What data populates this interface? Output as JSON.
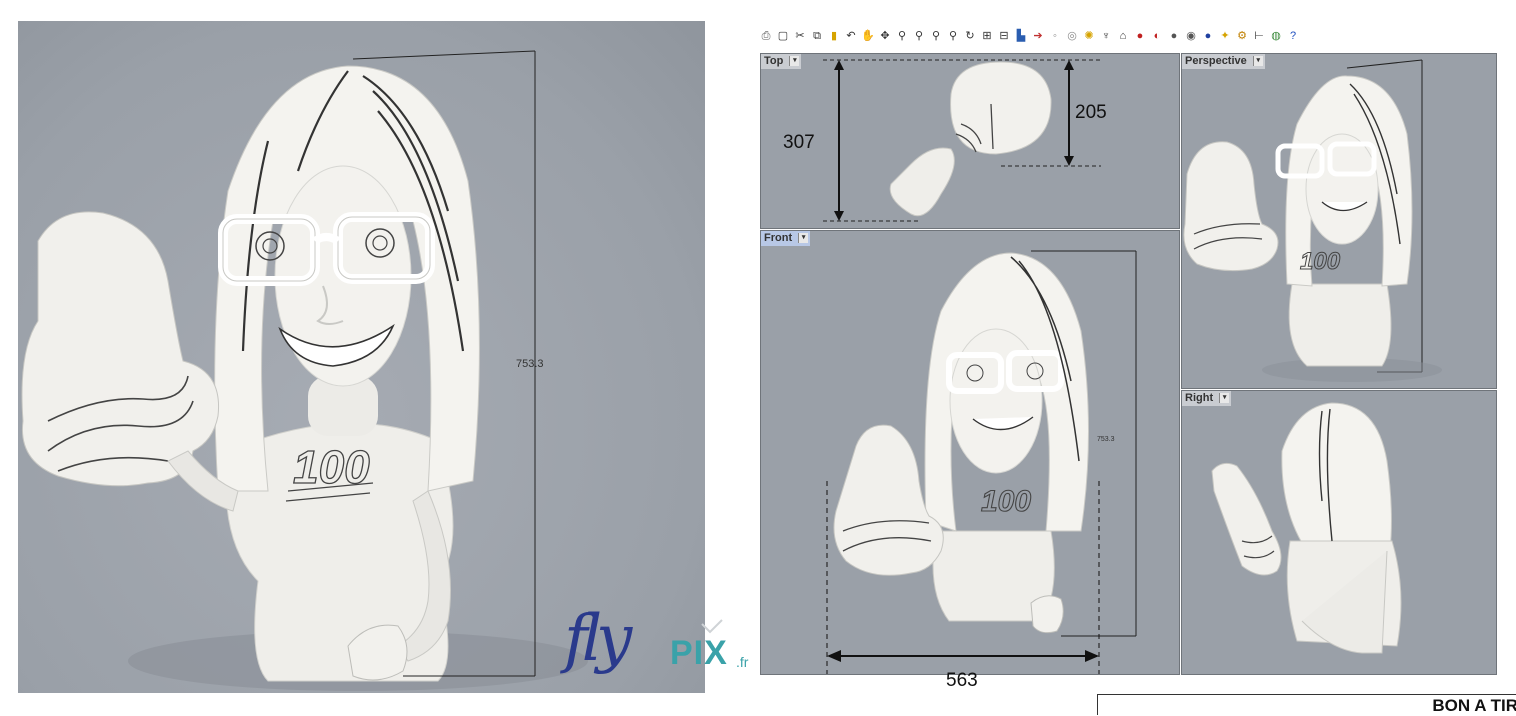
{
  "render": {
    "dimension_label": "753.3"
  },
  "toolbar": {
    "icons": [
      "print-icon",
      "new-icon",
      "cut-icon",
      "copy-icon",
      "paste-icon",
      "undo-icon",
      "pan-icon",
      "move-icon",
      "zoom-icon",
      "zoom-window-icon",
      "zoom-extents-icon",
      "zoom-selected-icon",
      "rotate-view-icon",
      "four-viewports-icon",
      "three-viewports-icon",
      "cplane-icon",
      "line-icon",
      "point-icon",
      "circle-icon",
      "light-icon",
      "lamp-icon",
      "lock-icon",
      "material-icon",
      "shade-icon",
      "sphere-icon",
      "render-icon",
      "globe-icon",
      "wand-icon",
      "gear-icon",
      "connect-icon",
      "earth-icon",
      "help-icon"
    ]
  },
  "viewports": {
    "top": {
      "label": "Top",
      "dim_total": "307",
      "dim_partial": "205"
    },
    "perspective": {
      "label": "Perspective"
    },
    "front": {
      "label": "Front",
      "dim_width": "563",
      "dim_height": "753.3"
    },
    "right": {
      "label": "Right"
    }
  },
  "logo": {
    "fly": "fly",
    "pix": "PIX",
    "tld": ".fr"
  },
  "bat": {
    "title": "BON A TIR"
  },
  "colors": {
    "viewport_bg": "#9aa0a8",
    "logo_blue": "#2a3a8c",
    "logo_teal": "#3aa2a9"
  }
}
